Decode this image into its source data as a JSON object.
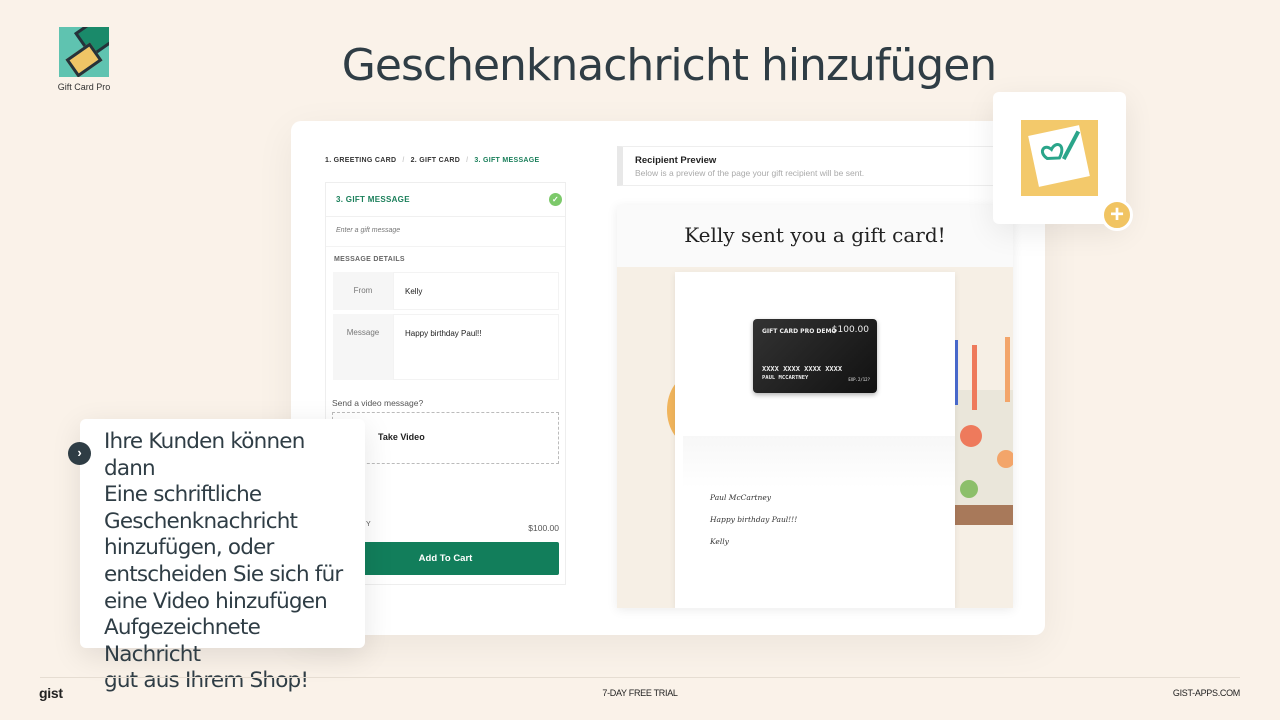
{
  "brand": {
    "logo_text": "Gift Card Pro"
  },
  "title": "Geschenknachricht hinzufügen",
  "breadcrumb": [
    "1. GREETING CARD",
    "2. GIFT CARD",
    "3. GIFT MESSAGE"
  ],
  "form": {
    "section_title": "3. GIFT MESSAGE",
    "message_placeholder": "Enter a gift message",
    "details_label": "MESSAGE DETAILS",
    "from_label": "From",
    "from_value": "Kelly",
    "message_label": "Message",
    "message_value": "Happy birthday Paul!!",
    "video_question": "Send a video message?",
    "video_button": "Take Video",
    "qty_label_partial": "Y",
    "price": "$100.00",
    "add_to_cart": "Add To Cart"
  },
  "preview": {
    "title": "Recipient Preview",
    "description": "Below is a preview of the page your gift recipient will be sent.",
    "heading": "Kelly sent you a gift card!",
    "card": {
      "brand": "GIFT CARD PRO DEMO",
      "amount": "$100.00",
      "number": "XXXX XXXX XXXX XXXX",
      "holder": "PAUL MCCARTNEY",
      "expiry": "EXP.2/12?"
    },
    "to": "Paul McCartney",
    "message": "Happy birthday Paul!!!",
    "from": "Kelly"
  },
  "callout": {
    "lines": [
      "Ihre Kunden können dann",
      "Eine schriftliche",
      "Geschenknachricht",
      "hinzufügen, oder",
      "entscheiden Sie sich für",
      "eine Video hinzufügen",
      "Aufgezeichnete Nachricht",
      "gut aus Ihrem Shop!"
    ]
  },
  "footer": {
    "logo": "gist",
    "center": "7-DAY FREE TRIAL",
    "right": "GIST-APPS.COM"
  },
  "colors": {
    "background": "#faf2e9",
    "accent_green": "#127e5b",
    "accent_yellow": "#f1c462",
    "text_dark": "#2f3d45"
  }
}
